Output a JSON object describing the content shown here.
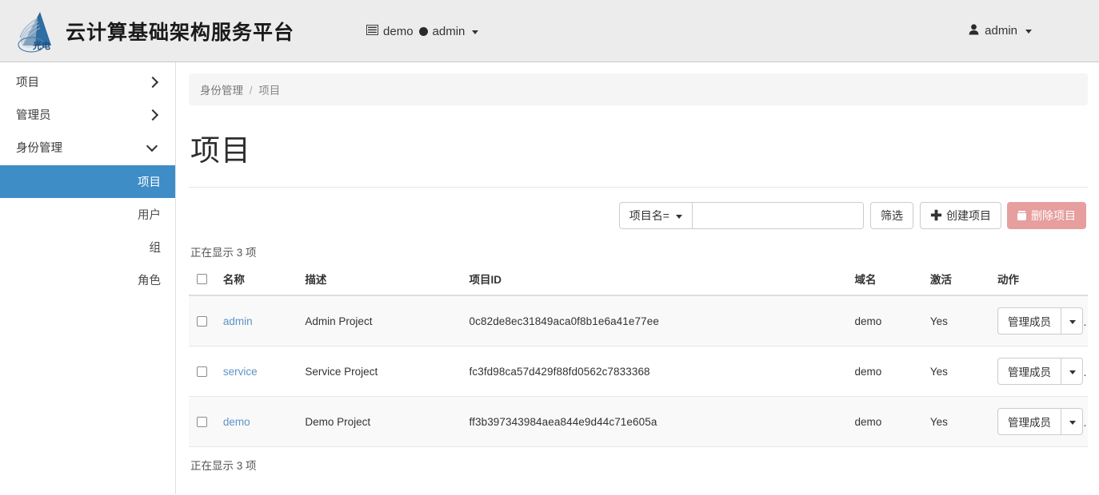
{
  "navbar": {
    "brand_title": "云计算基础架构服务平台",
    "logo_text": "光电",
    "logo_icon": "mountain-triangle-logo",
    "project_switcher": {
      "project_icon": "list-table-icon",
      "project_label": "demo",
      "domain_icon": "dot-icon",
      "domain_label": "admin",
      "caret_icon": "caret-down-icon"
    },
    "user_menu": {
      "user_icon": "user-person-icon",
      "label": "admin",
      "caret_icon": "caret-down-icon"
    }
  },
  "sidebar": {
    "groups": [
      {
        "label": "项目",
        "icon": "chevron-right-icon",
        "expanded": false
      },
      {
        "label": "管理员",
        "icon": "chevron-right-icon",
        "expanded": false
      },
      {
        "label": "身份管理",
        "icon": "chevron-down-icon",
        "expanded": true
      }
    ],
    "sub_items": [
      {
        "label": "项目",
        "active": true
      },
      {
        "label": "用户",
        "active": false
      },
      {
        "label": "组",
        "active": false
      },
      {
        "label": "角色",
        "active": false
      }
    ]
  },
  "breadcrumb": {
    "parent": "身份管理",
    "separator": "/",
    "current": "项目"
  },
  "page": {
    "title": "项目"
  },
  "toolbar": {
    "filter_key_label": "项目名=",
    "filter_key_caret": "caret-down-icon",
    "search_value": "",
    "search_placeholder": "",
    "filter_button": "筛选",
    "create_button": "创建项目",
    "create_icon": "plus-icon",
    "delete_button": "删除项目",
    "delete_icon": "trash-icon",
    "delete_color": "#e79e9e"
  },
  "table": {
    "count_top": "正在显示 3 项",
    "count_bottom": "正在显示 3 项",
    "select_all_checkbox": "",
    "headers": {
      "name": "名称",
      "description": "描述",
      "project_id": "项目ID",
      "domain": "域名",
      "enabled": "激活",
      "actions": "动作"
    },
    "action_button_label": "管理成员",
    "action_caret_icon": "caret-down-icon",
    "rows": [
      {
        "name": "admin",
        "description": "Admin Project",
        "project_id": "0c82de8ec31849aca0f8b1e6a41e77ee",
        "domain": "demo",
        "enabled": "Yes"
      },
      {
        "name": "service",
        "description": "Service Project",
        "project_id": "fc3fd98ca57d429f88fd0562c7833368",
        "domain": "demo",
        "enabled": "Yes"
      },
      {
        "name": "demo",
        "description": "Demo Project",
        "project_id": "ff3b397343984aea844e9d44c71e605a",
        "domain": "demo",
        "enabled": "Yes"
      }
    ]
  },
  "colors": {
    "accent_blue": "#3f8dc6",
    "link_blue": "#5c93c9",
    "danger": "#e79e9e",
    "navbar_bg": "#ececec"
  }
}
